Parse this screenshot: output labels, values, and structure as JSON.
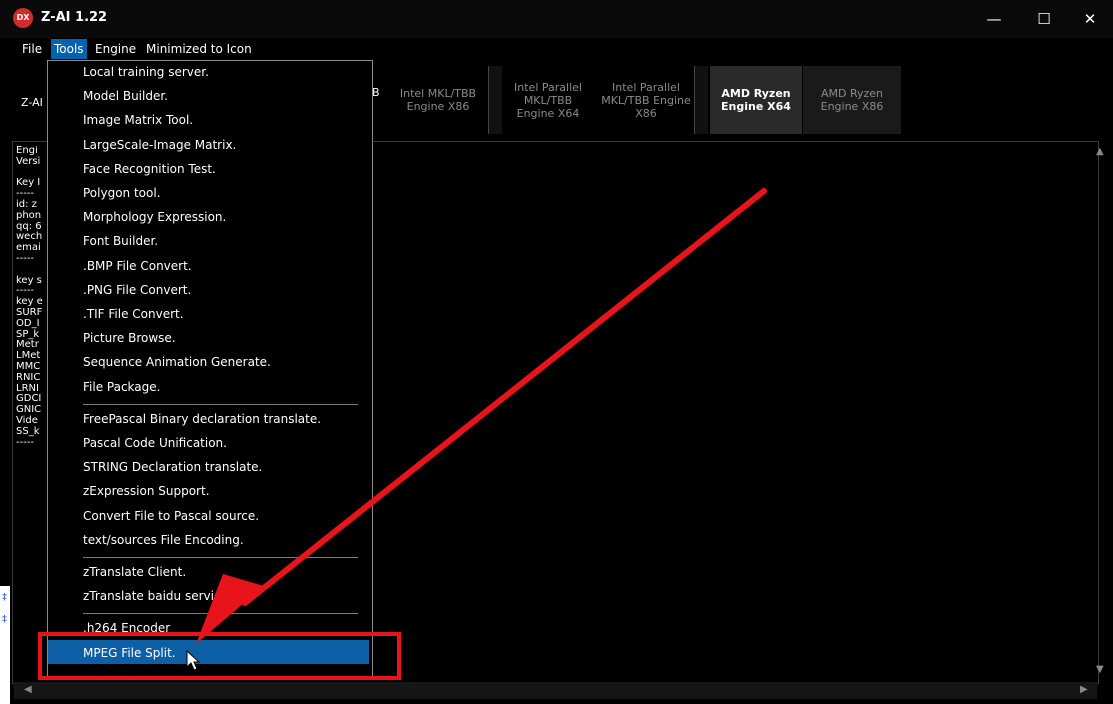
{
  "window": {
    "icon_text": "DX",
    "title": "Z-AI 1.22",
    "minimize": "—",
    "maximize": "☐",
    "close": "✕"
  },
  "menubar": [
    "File",
    "Tools",
    "Engine",
    "Minimized to Icon"
  ],
  "toolbar": {
    "label": "Z-AI",
    "partial_tab_top": "B",
    "engines": [
      {
        "label": "Intel MKL/TBB Engine X86",
        "selected": false
      },
      {
        "label": "Intel Parallel MKL/TBB Engine X64",
        "selected": false
      },
      {
        "label": "Intel Parallel MKL/TBB Engine X86",
        "selected": false
      },
      {
        "label": "AMD Ryzen Engine X64",
        "selected": true
      },
      {
        "label": "AMD Ryzen Engine X86",
        "selected": false
      }
    ]
  },
  "left_text": [
    "Engi",
    "Versi",
    "",
    "Key I",
    "-----",
    "id: z",
    "phon",
    "qq: 6",
    "wech",
    "emai",
    "-----",
    "",
    "key s",
    "-----",
    "key e",
    "SURF",
    "OD_I",
    "SP_k",
    "Metr",
    "LMet",
    "MMC",
    "RNIC",
    "LRNI",
    "GDCI",
    "GNIC",
    "Vide",
    "SS_k",
    "-----"
  ],
  "tools_menu": {
    "groups": [
      [
        "Local training server.",
        "Model Builder.",
        "Image Matrix Tool.",
        "LargeScale-Image Matrix.",
        "Face Recognition Test.",
        "Polygon tool.",
        "Morphology Expression.",
        "Font Builder.",
        ".BMP File Convert.",
        ".PNG File Convert.",
        ".TIF File Convert.",
        "Picture Browse.",
        "Sequence Animation Generate.",
        "File Package."
      ],
      [
        "FreePascal Binary declaration translate.",
        "Pascal Code Unification.",
        "STRING Declaration translate.",
        "zExpression Support.",
        "Convert File to Pascal source.",
        "text/sources File Encoding."
      ],
      [
        "zTranslate Client.",
        "zTranslate baidu service."
      ],
      [
        ".h264 Encoder",
        "MPEG File Split."
      ]
    ],
    "highlighted": "MPEG File Split."
  },
  "colors": {
    "annotation": "#e8141c",
    "highlight": "#0d5fa6",
    "active_menu": "#0063b1"
  }
}
